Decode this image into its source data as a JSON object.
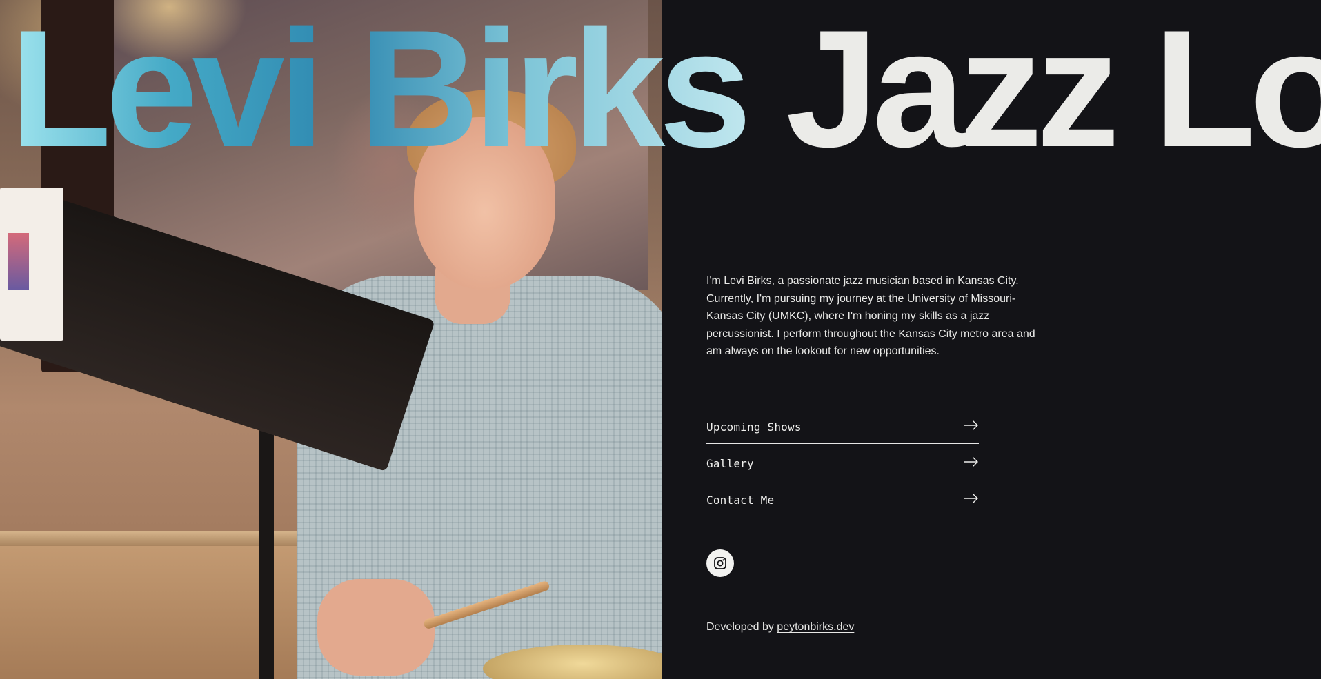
{
  "hero": {
    "title_first": "Levi Birks",
    "title_rest": " Jazz Lo",
    "photo_alt": "Levi Birks playing drums"
  },
  "bio": {
    "text": "I'm Levi Birks, a passionate jazz musician based in Kansas City. Currently, I'm pursuing my journey at the University of Missouri-Kansas City (UMKC), where I'm honing my skills as a jazz percussionist. I perform throughout the Kansas City metro area and am always on the lookout for new opportunities."
  },
  "nav": {
    "items": [
      {
        "label": "Upcoming Shows",
        "icon": "arrow-right-icon"
      },
      {
        "label": "Gallery",
        "icon": "arrow-right-icon"
      },
      {
        "label": "Contact Me",
        "icon": "arrow-right-icon"
      }
    ]
  },
  "social": {
    "instagram_icon": "instagram-icon"
  },
  "footer": {
    "prefix": "Developed by ",
    "link_text": "peytonbirks.dev"
  },
  "colors": {
    "background": "#131317",
    "text": "#ebebe8",
    "accent_tint": "#44a9c6"
  }
}
